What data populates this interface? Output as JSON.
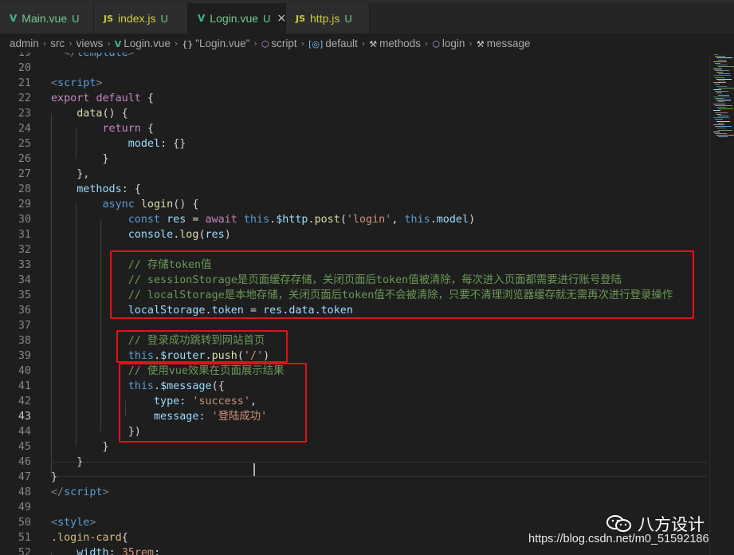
{
  "tabs": [
    {
      "name": "Main.vue",
      "status": "U",
      "type": "vue",
      "active": false
    },
    {
      "name": "index.js",
      "status": "U",
      "type": "js",
      "active": false
    },
    {
      "name": "Login.vue",
      "status": "U",
      "type": "vue",
      "active": true
    },
    {
      "name": "http.js",
      "status": "U",
      "type": "js",
      "active": false
    }
  ],
  "tab_icons": {
    "vue": "V",
    "js": "JS",
    "close": "×"
  },
  "breadcrumb": [
    {
      "label": "admin",
      "icon": ""
    },
    {
      "label": "src",
      "icon": ""
    },
    {
      "label": "views",
      "icon": ""
    },
    {
      "label": "Login.vue",
      "icon": "vue-icon"
    },
    {
      "label": "\"Login.vue\"",
      "icon": "braces-icon"
    },
    {
      "label": "script",
      "icon": "cube-icon"
    },
    {
      "label": "default",
      "icon": "field-icon"
    },
    {
      "label": "methods",
      "icon": "wrench-icon"
    },
    {
      "label": "login",
      "icon": "cube-icon"
    },
    {
      "label": "message",
      "icon": "wrench-icon"
    }
  ],
  "current_line": 43,
  "code_lines": [
    {
      "n": 19,
      "tokens": [
        [
          "  ",
          "plain"
        ],
        [
          "</",
          "punct"
        ],
        [
          "template",
          "tag"
        ],
        [
          ">",
          "punct"
        ]
      ]
    },
    {
      "n": 20,
      "tokens": []
    },
    {
      "n": 21,
      "tokens": [
        [
          "<",
          "punct"
        ],
        [
          "script",
          "tag"
        ],
        [
          ">",
          "punct"
        ]
      ]
    },
    {
      "n": 22,
      "tokens": [
        [
          "export",
          "ctrl"
        ],
        [
          " ",
          "plain"
        ],
        [
          "default",
          "ctrl"
        ],
        [
          " {",
          "plain"
        ]
      ]
    },
    {
      "n": 23,
      "tokens": [
        [
          "    ",
          "plain"
        ],
        [
          "data",
          "fn"
        ],
        [
          "() {",
          "plain"
        ]
      ]
    },
    {
      "n": 24,
      "tokens": [
        [
          "        ",
          "plain"
        ],
        [
          "return",
          "ctrl"
        ],
        [
          " {",
          "plain"
        ]
      ]
    },
    {
      "n": 25,
      "tokens": [
        [
          "            ",
          "plain"
        ],
        [
          "model",
          "prop"
        ],
        [
          ": {}",
          "plain"
        ]
      ]
    },
    {
      "n": 26,
      "tokens": [
        [
          "        }",
          "plain"
        ]
      ]
    },
    {
      "n": 27,
      "tokens": [
        [
          "    },",
          "plain"
        ]
      ]
    },
    {
      "n": 28,
      "tokens": [
        [
          "    ",
          "plain"
        ],
        [
          "methods",
          "prop"
        ],
        [
          ": {",
          "plain"
        ]
      ]
    },
    {
      "n": 29,
      "tokens": [
        [
          "        ",
          "plain"
        ],
        [
          "async",
          "kw"
        ],
        [
          " ",
          "plain"
        ],
        [
          "login",
          "fn"
        ],
        [
          "() {",
          "plain"
        ]
      ]
    },
    {
      "n": 30,
      "tokens": [
        [
          "            ",
          "plain"
        ],
        [
          "const",
          "kw"
        ],
        [
          " ",
          "plain"
        ],
        [
          "res",
          "prop"
        ],
        [
          " = ",
          "plain"
        ],
        [
          "await",
          "ctrl"
        ],
        [
          " ",
          "plain"
        ],
        [
          "this",
          "kw"
        ],
        [
          ".",
          "plain"
        ],
        [
          "$http",
          "prop"
        ],
        [
          ".",
          "plain"
        ],
        [
          "post",
          "fn"
        ],
        [
          "(",
          "plain"
        ],
        [
          "'login'",
          "str"
        ],
        [
          ", ",
          "plain"
        ],
        [
          "this",
          "kw"
        ],
        [
          ".",
          "plain"
        ],
        [
          "model",
          "prop"
        ],
        [
          ")",
          "plain"
        ]
      ]
    },
    {
      "n": 31,
      "tokens": [
        [
          "            ",
          "plain"
        ],
        [
          "console",
          "prop"
        ],
        [
          ".",
          "plain"
        ],
        [
          "log",
          "fn"
        ],
        [
          "(",
          "plain"
        ],
        [
          "res",
          "prop"
        ],
        [
          ")",
          "plain"
        ]
      ]
    },
    {
      "n": 32,
      "tokens": []
    },
    {
      "n": 33,
      "tokens": [
        [
          "            ",
          "plain"
        ],
        [
          "// 存储token值",
          "cmt"
        ]
      ]
    },
    {
      "n": 34,
      "tokens": [
        [
          "            ",
          "plain"
        ],
        [
          "// sessionStorage是页面缓存存储，关闭页面后token值被清除，每次进入页面都需要进行账号登陆",
          "cmt"
        ]
      ]
    },
    {
      "n": 35,
      "tokens": [
        [
          "            ",
          "plain"
        ],
        [
          "// localStorage是本地存储，关闭页面后token值不会被清除，只要不清理浏览器缓存就无需再次进行登录操作",
          "cmt"
        ]
      ]
    },
    {
      "n": 36,
      "tokens": [
        [
          "            ",
          "plain"
        ],
        [
          "localStorage",
          "prop"
        ],
        [
          ".",
          "plain"
        ],
        [
          "token",
          "prop"
        ],
        [
          " = ",
          "plain"
        ],
        [
          "res",
          "prop"
        ],
        [
          ".",
          "plain"
        ],
        [
          "data",
          "prop"
        ],
        [
          ".",
          "plain"
        ],
        [
          "token",
          "prop"
        ]
      ]
    },
    {
      "n": 37,
      "tokens": []
    },
    {
      "n": 38,
      "tokens": [
        [
          "            ",
          "plain"
        ],
        [
          "// 登录成功跳转到网站首页",
          "cmt"
        ]
      ]
    },
    {
      "n": 39,
      "tokens": [
        [
          "            ",
          "plain"
        ],
        [
          "this",
          "kw"
        ],
        [
          ".",
          "plain"
        ],
        [
          "$router",
          "prop"
        ],
        [
          ".",
          "plain"
        ],
        [
          "push",
          "fn"
        ],
        [
          "(",
          "plain"
        ],
        [
          "'/'",
          "str"
        ],
        [
          ")",
          "plain"
        ]
      ]
    },
    {
      "n": 40,
      "tokens": [
        [
          "            ",
          "plain"
        ],
        [
          "// 使用vue效果在页面展示结果",
          "cmt"
        ]
      ]
    },
    {
      "n": 41,
      "tokens": [
        [
          "            ",
          "plain"
        ],
        [
          "this",
          "kw"
        ],
        [
          ".",
          "plain"
        ],
        [
          "$message",
          "prop"
        ],
        [
          "({",
          "plain"
        ]
      ]
    },
    {
      "n": 42,
      "tokens": [
        [
          "                ",
          "plain"
        ],
        [
          "type",
          "prop"
        ],
        [
          ": ",
          "plain"
        ],
        [
          "'success'",
          "str"
        ],
        [
          ",",
          "plain"
        ]
      ]
    },
    {
      "n": 43,
      "tokens": [
        [
          "                ",
          "plain"
        ],
        [
          "message",
          "prop"
        ],
        [
          ": ",
          "plain"
        ],
        [
          "'登陆成功'",
          "str"
        ]
      ]
    },
    {
      "n": 44,
      "tokens": [
        [
          "            ",
          "plain"
        ],
        [
          "})",
          "plain"
        ]
      ]
    },
    {
      "n": 45,
      "tokens": [
        [
          "        }",
          "plain"
        ]
      ]
    },
    {
      "n": 46,
      "tokens": [
        [
          "    }",
          "plain"
        ]
      ]
    },
    {
      "n": 47,
      "tokens": [
        [
          "}",
          "plain"
        ]
      ]
    },
    {
      "n": 48,
      "tokens": [
        [
          "</",
          "punct"
        ],
        [
          "script",
          "tag"
        ],
        [
          ">",
          "punct"
        ]
      ]
    },
    {
      "n": 49,
      "tokens": []
    },
    {
      "n": 50,
      "tokens": [
        [
          "<",
          "punct"
        ],
        [
          "style",
          "tag"
        ],
        [
          ">",
          "punct"
        ]
      ]
    },
    {
      "n": 51,
      "tokens": [
        [
          ".login-card",
          "cls"
        ],
        [
          "{",
          "plain"
        ]
      ]
    },
    {
      "n": 52,
      "tokens": [
        [
          "    ",
          "plain"
        ],
        [
          "width",
          "prop"
        ],
        [
          ": ",
          "plain"
        ],
        [
          "35rem",
          "str"
        ],
        [
          ";",
          "plain"
        ]
      ]
    }
  ],
  "colors": {
    "background": "#1e1e1e",
    "annotation_box": "#e5111a",
    "comment": "#6a9955",
    "string": "#ce9178",
    "keyword": "#569cd6"
  },
  "watermark": {
    "brand": "八方设计",
    "url": "https://blog.csdn.net/m0_51592186",
    "icon": "wechat-icon"
  }
}
